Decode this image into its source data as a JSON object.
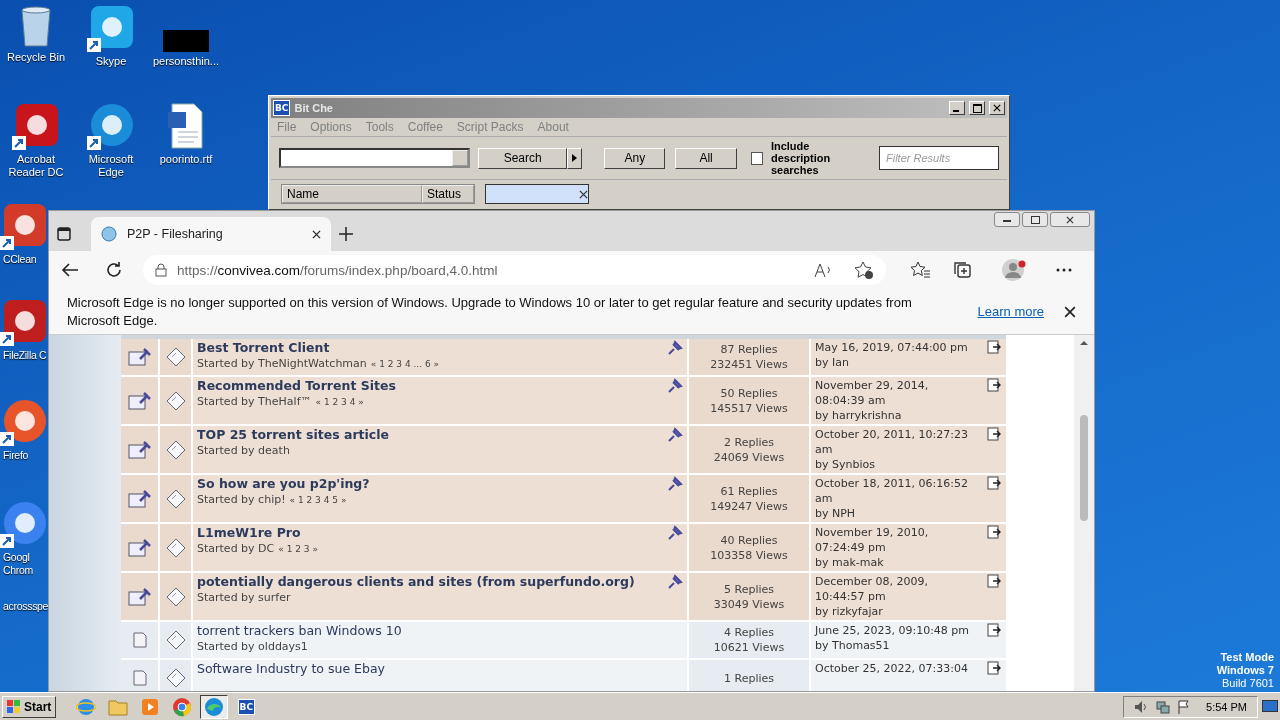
{
  "desktop_icons": [
    {
      "label": "Recycle Bin",
      "kind": "bin"
    },
    {
      "label": "Skype",
      "kind": "app"
    },
    {
      "label": "personsthin...",
      "kind": "blank"
    },
    {
      "label": "Acrobat Reader DC",
      "kind": "app"
    },
    {
      "label": "Microsoft Edge",
      "kind": "app"
    },
    {
      "label": "poorinto.rtf",
      "kind": "document"
    },
    {
      "label": "CClean",
      "kind": "app"
    },
    {
      "label": "FileZilla C",
      "kind": "app"
    },
    {
      "label": "Firefo",
      "kind": "app"
    },
    {
      "label": "Googl Chrom",
      "kind": "app"
    },
    {
      "label": "acrossspe",
      "kind": "none"
    }
  ],
  "bitche": {
    "logo": "BC",
    "title": "Bit Che",
    "menu": [
      "File",
      "Options",
      "Tools",
      "Coffee",
      "Script Packs",
      "About"
    ],
    "search_button": "Search",
    "buttons": [
      "Any",
      "All"
    ],
    "include_description": {
      "label": "Include description searches",
      "checked": false
    },
    "filter": {
      "placeholder": "Filter Results"
    },
    "list_columns": [
      "Name",
      "Status"
    ]
  },
  "browser": {
    "tab": {
      "title": "P2P - Filesharing",
      "selected": true
    },
    "url": {
      "scheme": "https://",
      "host": "convivea.com",
      "path": "/forums/index.php/board,4.0.html"
    },
    "banner": {
      "text": "Microsoft Edge is no longer supported on this version of Windows. Upgrade to Windows 10 or later to get regular feature and security updates from Microsoft Edge.",
      "link": "Learn more"
    },
    "topics": [
      {
        "sticky": true,
        "title": "Best Torrent Client",
        "starter": "Started by TheNightWatchman",
        "pages": "« 1 2 3 4 ... 6 »",
        "replies": "87 Replies",
        "views": "232451 Views",
        "date": "May 16, 2019, 07:44:00 pm",
        "by": "by Ian"
      },
      {
        "sticky": true,
        "title": "Recommended Torrent Sites",
        "starter": "Started by TheHalf™",
        "pages": "« 1 2 3 4 »",
        "replies": "50 Replies",
        "views": "145517 Views",
        "date": "November 29, 2014, 08:04:39 am",
        "by": "by harrykrishna"
      },
      {
        "sticky": true,
        "title": "TOP 25 torrent sites article",
        "starter": "Started by death",
        "replies": "2 Replies",
        "views": "24069 Views",
        "date": "October 20, 2011, 10:27:23 am",
        "by": "by Synbios"
      },
      {
        "sticky": true,
        "title": "So how are you p2p'ing?",
        "starter": "Started by chip!",
        "pages": "« 1 2 3 4 5 »",
        "replies": "61 Replies",
        "views": "149247 Views",
        "date": "October 18, 2011, 06:16:52 am",
        "by": "by NPH"
      },
      {
        "sticky": true,
        "title": "L1meW1re Pro",
        "starter": "Started by DC",
        "pages": "« 1 2 3 »",
        "replies": "40 Replies",
        "views": "103358 Views",
        "date": "November 19, 2010, 07:24:49 pm",
        "by": "by mak-mak"
      },
      {
        "sticky": true,
        "title": "potentially dangerous clients and sites (from superfundo.org)",
        "starter": "Started by surfer",
        "replies": "5 Replies",
        "views": "33049 Views",
        "date": "December 08, 2009, 10:44:57 pm",
        "by": "by rizkyfajar"
      },
      {
        "sticky": false,
        "title": "torrent trackers ban Windows 10",
        "starter": "Started by olddays1",
        "replies": "4 Replies",
        "views": "10621 Views",
        "date": "June 25, 2023, 09:10:48 pm",
        "by": "by Thomas51"
      },
      {
        "sticky": false,
        "title": "Software Industry to sue Ebay",
        "replies": "1 Replies",
        "date": "October 25, 2022, 07:33:04"
      }
    ]
  },
  "taskbar": {
    "start": "Start",
    "items": [
      {
        "kind": "ie",
        "selected": false
      },
      {
        "kind": "folder",
        "selected": false
      },
      {
        "kind": "media",
        "selected": false
      },
      {
        "kind": "chrome",
        "selected": false
      },
      {
        "kind": "edge",
        "selected": true
      },
      {
        "kind": "bc",
        "label": "BC",
        "selected": false
      }
    ],
    "clock": "5:54 PM"
  },
  "test_mode": [
    "Test Mode",
    "Windows 7",
    "Build 7601"
  ]
}
